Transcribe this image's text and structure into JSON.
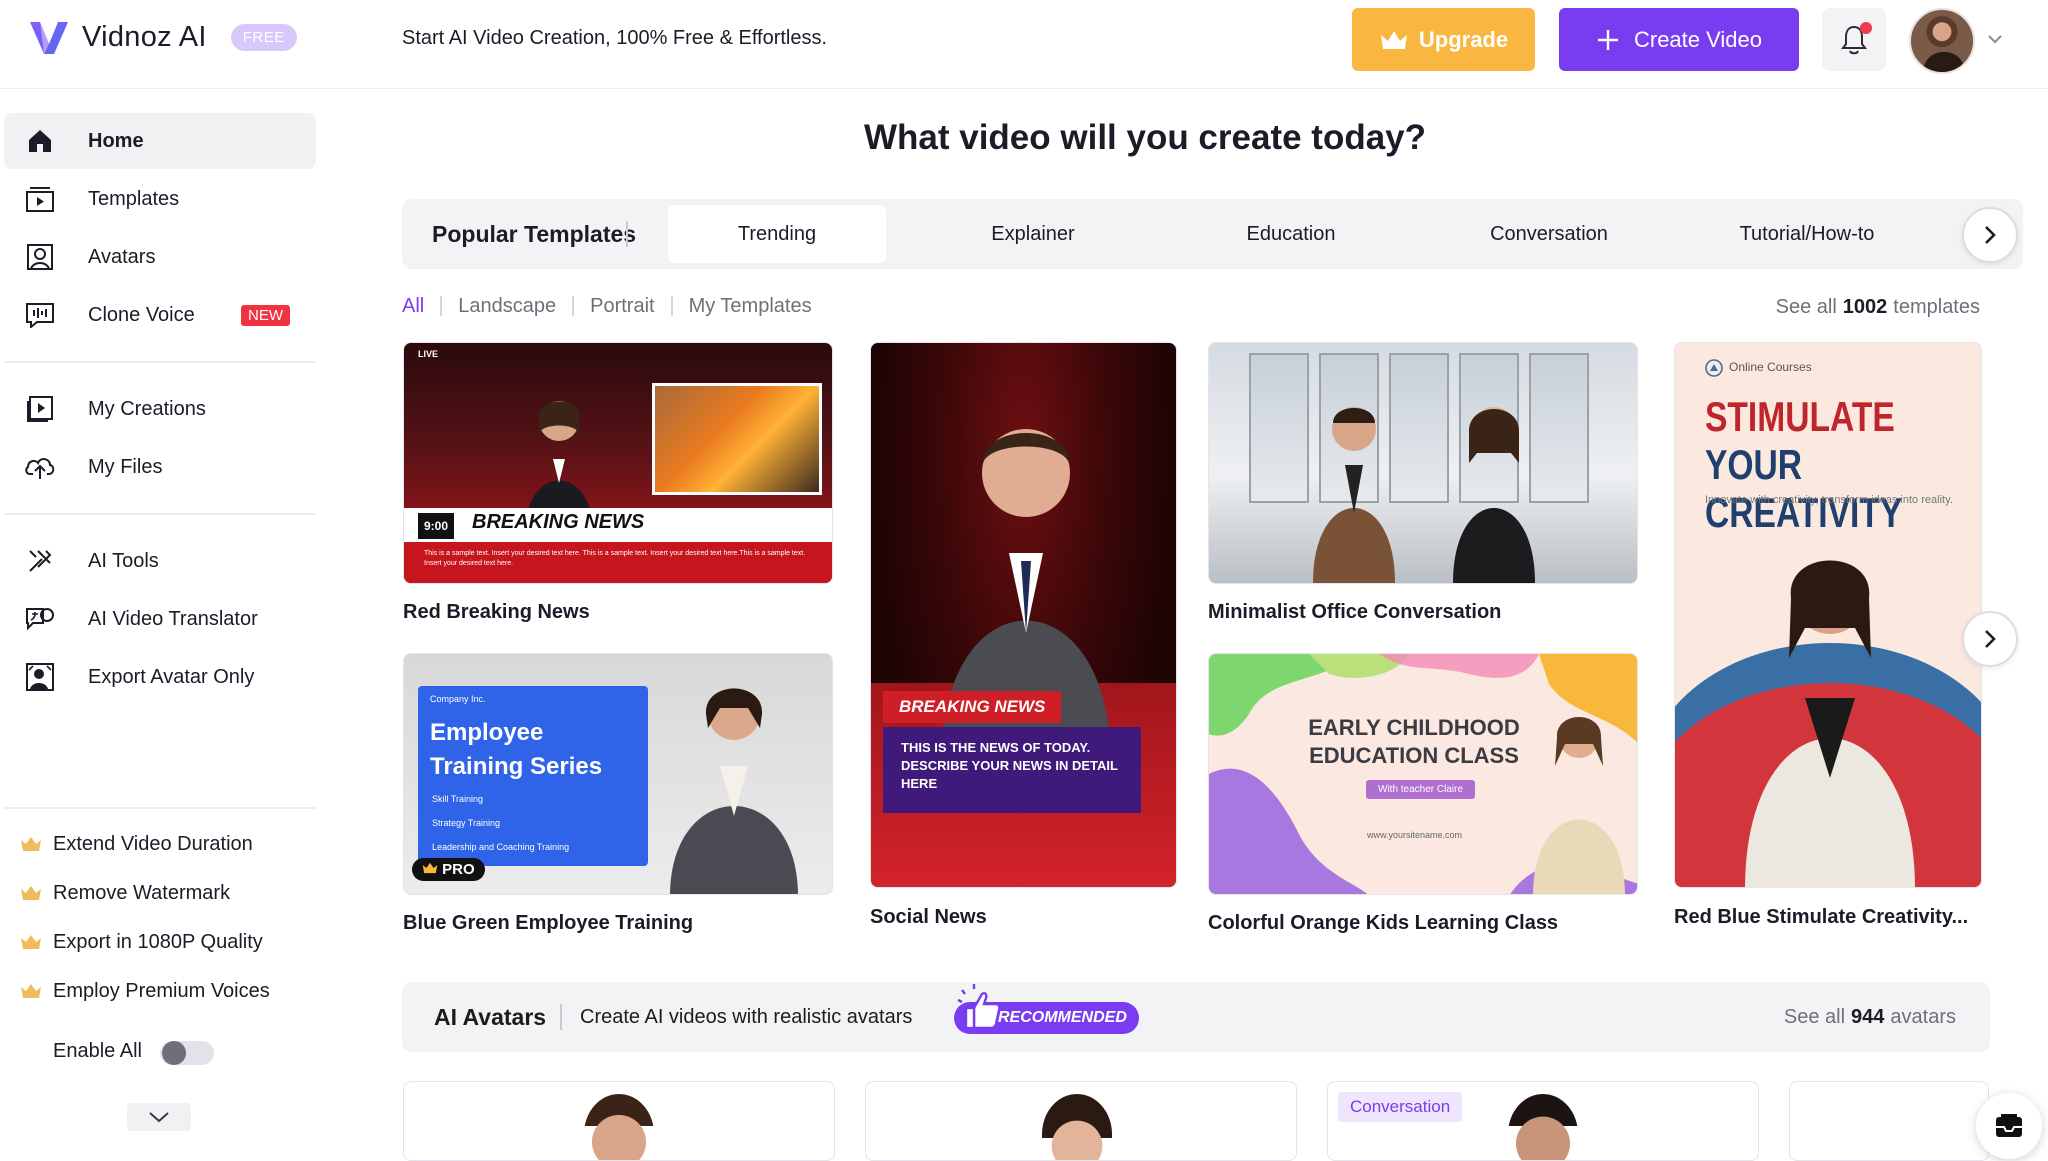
{
  "header": {
    "brand": "Vidnoz AI",
    "plan_badge": "FREE",
    "tagline": "Start AI Video Creation, 100% Free & Effortless.",
    "upgrade_label": "Upgrade",
    "create_label": "Create Video"
  },
  "sidebar": {
    "items": [
      {
        "label": "Home"
      },
      {
        "label": "Templates"
      },
      {
        "label": "Avatars"
      },
      {
        "label": "Clone Voice",
        "badge": "NEW"
      },
      {
        "label": "My Creations"
      },
      {
        "label": "My Files"
      },
      {
        "label": "AI Tools"
      },
      {
        "label": "AI Video Translator"
      },
      {
        "label": "Export Avatar Only"
      }
    ],
    "perks": [
      "Extend Video Duration",
      "Remove Watermark",
      "Export in 1080P Quality",
      "Employ Premium Voices"
    ],
    "enable_all": "Enable All"
  },
  "main": {
    "title": "What video will you create today?",
    "popular_title": "Popular Templates",
    "tabs": [
      "Trending",
      "Explainer",
      "Education",
      "Conversation",
      "Tutorial/How-to"
    ],
    "filters": [
      "All",
      "Landscape",
      "Portrait",
      "My Templates"
    ],
    "see_all_prefix": "See all",
    "see_all_count": "1002",
    "see_all_suffix": "templates",
    "templates": [
      {
        "title": "Red Breaking News"
      },
      {
        "title": "Social News"
      },
      {
        "title": "Minimalist Office Conversation"
      },
      {
        "title": "Red Blue Stimulate Creativity..."
      },
      {
        "title": "Blue Green Employee Training"
      },
      {
        "title": "Colorful Orange Kids Learning Class"
      }
    ],
    "thumbs": {
      "t1_live": "LIVE",
      "t1_time": "9:00",
      "t1_headline": "BREAKING NEWS",
      "t1_ticker": "This is a sample text. Insert your desired text here. This is a sample text. Insert your desired text here.This is a sample text. Insert your desired text here.",
      "t2_label": "BREAKING NEWS",
      "t2_text": "THIS IS THE  NEWS OF TODAY. DESCRIBE YOUR NEWS IN DETAIL HERE",
      "t4_brand": "Online Courses",
      "t4_line1": "STIMULATE",
      "t4_line2": "YOUR CREATIVITY",
      "t4_sub": "Innovate with creativity, transform ideas into reality.",
      "t5_company": "Company Inc.",
      "t5_title1": "Employee",
      "t5_title2": "Training Series",
      "t5_li1": "Skill Training",
      "t5_li2": "Strategy Training",
      "t5_li3": "Leadership and Coaching Training",
      "t5_pro": "PRO",
      "t6_title": "EARLY CHILDHOOD EDUCATION CLASS",
      "t6_pill": "With teacher Claire",
      "t6_url": "www.yoursitename.com"
    },
    "avatars": {
      "title": "AI Avatars",
      "subtitle": "Create AI videos with realistic avatars",
      "recommended": "RECOMMENDED",
      "see_all_prefix": "See all",
      "see_all_count": "944",
      "see_all_suffix": "avatars",
      "card_tag": "Conversation"
    }
  },
  "colors": {
    "accent": "#7a3cf0",
    "upgrade": "#f9b640",
    "new_badge": "#ef3340"
  }
}
